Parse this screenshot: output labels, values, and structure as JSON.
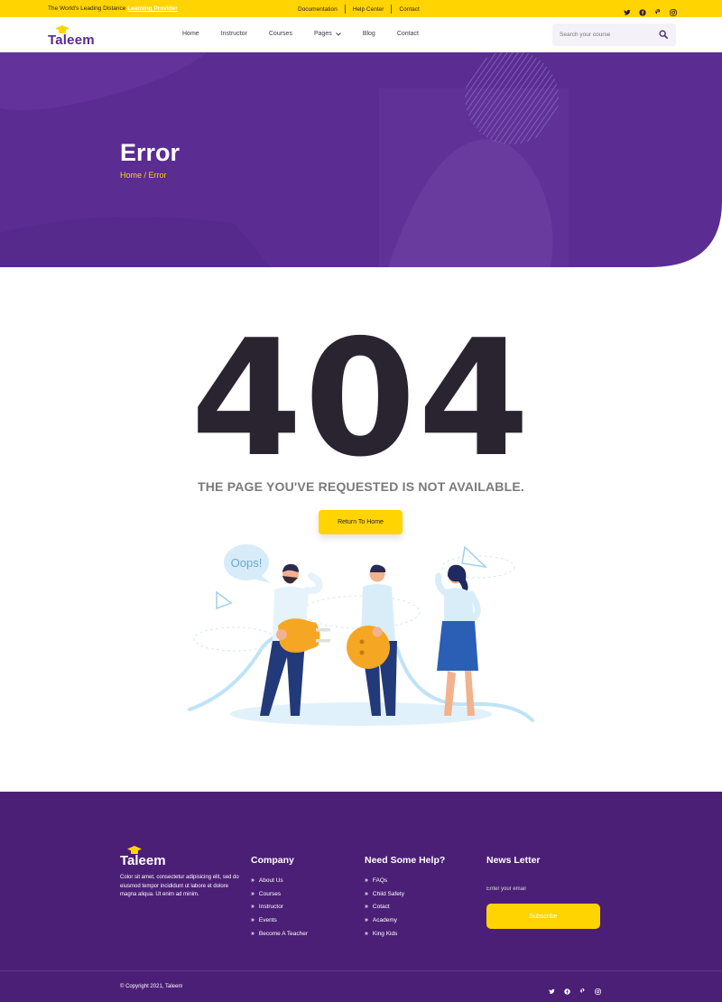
{
  "topbar": {
    "tagline": "The World's Leading Distance ",
    "tagline_highlight": "Learning Provider",
    "links": [
      "Documentation",
      "Help Center",
      "Contact"
    ],
    "social_icons": [
      "twitter-icon",
      "facebook-icon",
      "pinterest-icon",
      "instagram-icon"
    ]
  },
  "header": {
    "logo_text": "Taleem",
    "nav": [
      "Home",
      "Instructor",
      "Courses",
      "Pages",
      "Blog",
      "Contact"
    ],
    "search_placeholder": "Search your course"
  },
  "hero": {
    "title": "Error",
    "breadcrumb": "Home / Error"
  },
  "error": {
    "code": "404",
    "message": "THE PAGE YOU'VE REQUESTED IS NOT AVAILABLE.",
    "button": "Return To Home",
    "bubble_text": "Oops!"
  },
  "footer": {
    "logo_text": "Taleem",
    "description": "Color sit amet, consectetur adipisicing elit, sed do eiusmod tempor incididunt ut labore et dolore magna aliqua. Ut enim ad minim.",
    "company": {
      "heading": "Company",
      "items": [
        "About Us",
        "Courses",
        "Instructor",
        "Events",
        "Become A Teacher"
      ]
    },
    "help": {
      "heading": "Need Some Help?",
      "items": [
        "FAQs",
        "Child Safety",
        "Cotact",
        "Academy",
        "King Kids"
      ]
    },
    "newsletter": {
      "heading": "News Letter",
      "placeholder": "Enter your email",
      "button": "Subscribe"
    },
    "copyright": "© Copyright 2021, Taleem",
    "social_icons": [
      "twitter-icon",
      "facebook-icon",
      "pinterest-icon",
      "instagram-icon"
    ]
  },
  "colors": {
    "brand_yellow": "#ffd400",
    "brand_purple": "#4b1f76",
    "hero_purple": "#5b2c92",
    "text_dark": "#2a2430"
  }
}
